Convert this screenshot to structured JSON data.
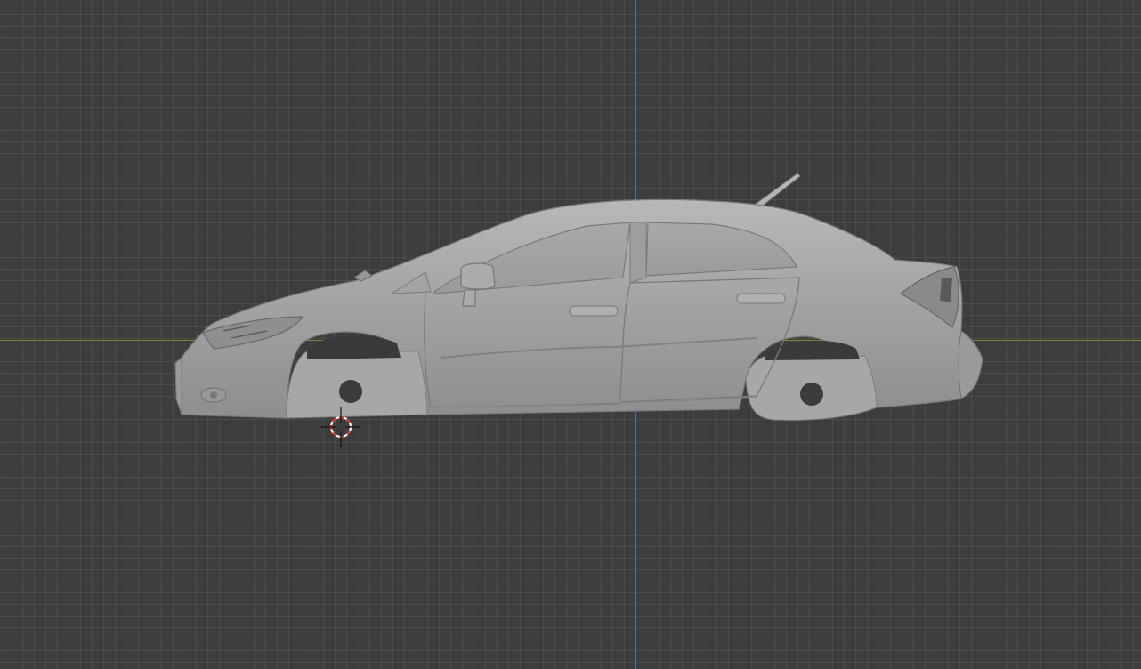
{
  "viewport": {
    "name": "3D viewport",
    "background": "#3d3d3d",
    "grid_color": "#4a4a4a"
  },
  "axes": {
    "x_axis_color": "#6f8b39",
    "y_axis_color": "#3f74a8"
  },
  "object": {
    "name": "car-mesh",
    "type": "sedan body (side view, wheels removed)",
    "color": "#a3a3a3"
  },
  "cursor": {
    "icon": "3d-cursor-icon",
    "colors": [
      "#e23a3a",
      "#ffffff"
    ]
  }
}
